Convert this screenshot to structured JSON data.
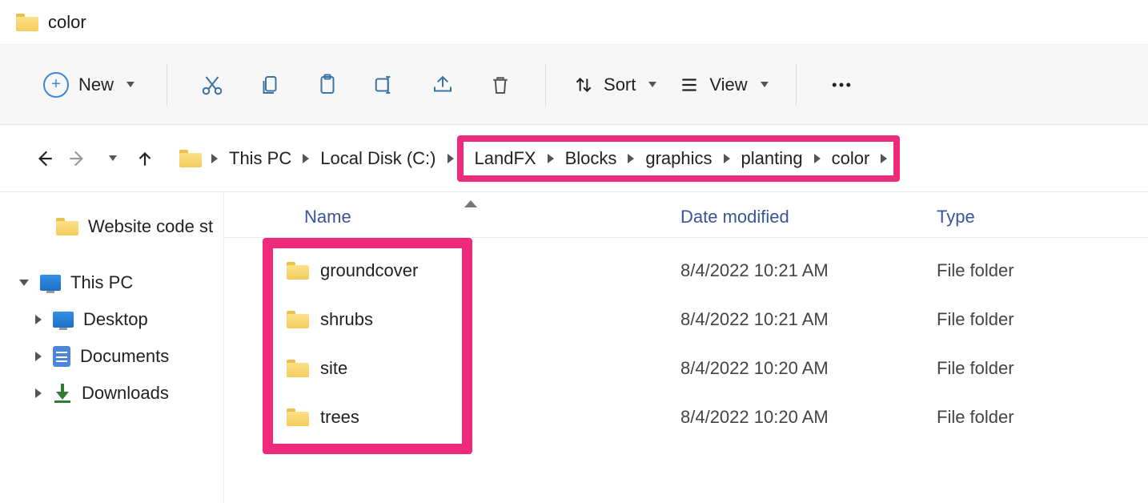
{
  "title": "color",
  "toolbar": {
    "new_label": "New",
    "sort_label": "Sort",
    "view_label": "View"
  },
  "breadcrumb": [
    "This PC",
    "Local Disk (C:)",
    "LandFX",
    "Blocks",
    "graphics",
    "planting",
    "color"
  ],
  "breadcrumb_highlight_start": 2,
  "sidebar": {
    "items": [
      {
        "label": "Website code st",
        "icon": "folder",
        "level": 2
      },
      {
        "label": "This PC",
        "icon": "pc",
        "level": 0,
        "expanded": true
      },
      {
        "label": "Desktop",
        "icon": "pc",
        "level": 1,
        "has_children": true
      },
      {
        "label": "Documents",
        "icon": "doc",
        "level": 1,
        "has_children": true
      },
      {
        "label": "Downloads",
        "icon": "download",
        "level": 1,
        "has_children": true
      }
    ]
  },
  "columns": {
    "name": "Name",
    "date": "Date modified",
    "type": "Type"
  },
  "files": [
    {
      "name": "groundcover",
      "date": "8/4/2022 10:21 AM",
      "type": "File folder"
    },
    {
      "name": "shrubs",
      "date": "8/4/2022 10:21 AM",
      "type": "File folder"
    },
    {
      "name": "site",
      "date": "8/4/2022 10:20 AM",
      "type": "File folder"
    },
    {
      "name": "trees",
      "date": "8/4/2022 10:20 AM",
      "type": "File folder"
    }
  ],
  "colors": {
    "accent_blue": "#3a86d8",
    "highlight_pink": "#ed2a7b",
    "header_link": "#3a549c"
  }
}
